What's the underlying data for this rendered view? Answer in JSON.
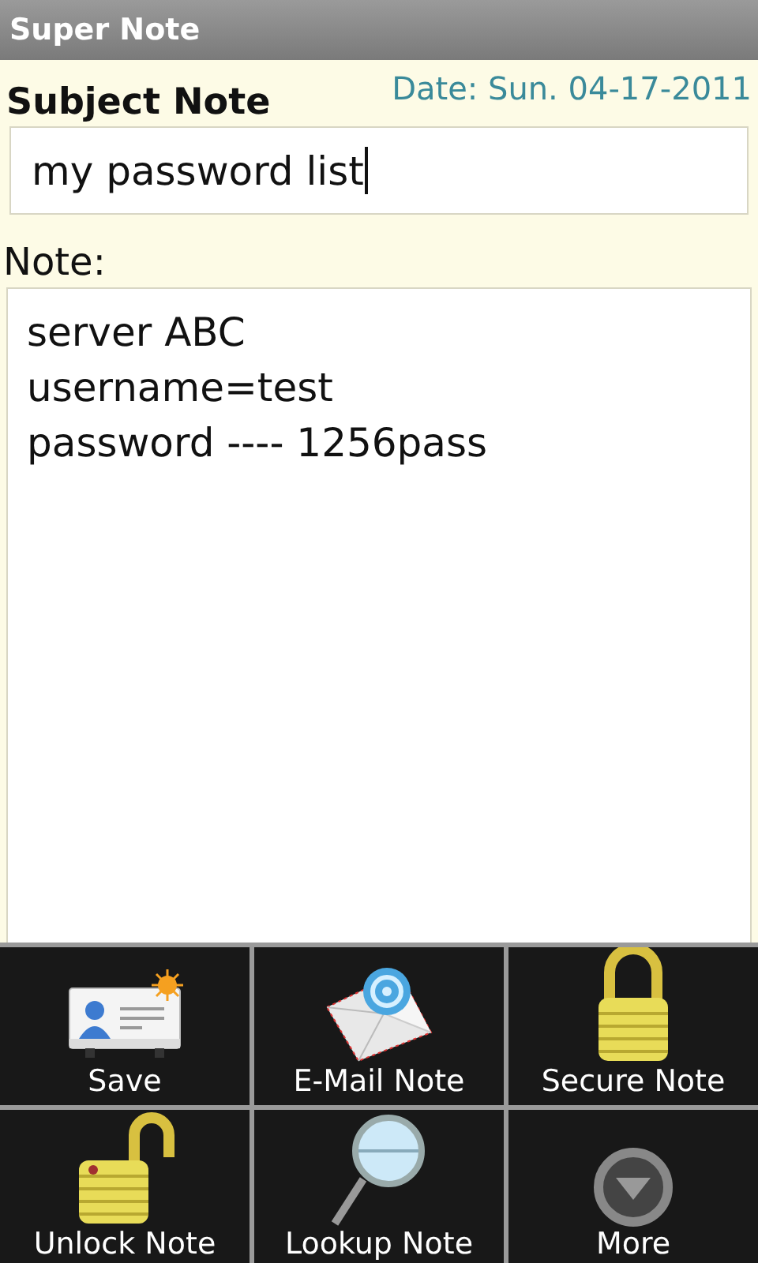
{
  "window": {
    "title": "Super Note"
  },
  "form": {
    "subject_label": "Subject Note",
    "date": "Date: Sun. 04-17-2011",
    "subject_value": "my password list",
    "subject_focused": true,
    "note_label": "Note:",
    "note_lines": [
      "server ABC",
      "username=test",
      "password ---- 1256pass"
    ]
  },
  "menu": [
    {
      "label": "Save",
      "kind": "card"
    },
    {
      "label": "E-Mail Note",
      "kind": "mail"
    },
    {
      "label": "Secure Note",
      "kind": "lock"
    },
    {
      "label": "Unlock Note",
      "kind": "unlock"
    },
    {
      "label": "Lookup Note",
      "kind": "search"
    },
    {
      "label": "More",
      "kind": "more"
    }
  ]
}
